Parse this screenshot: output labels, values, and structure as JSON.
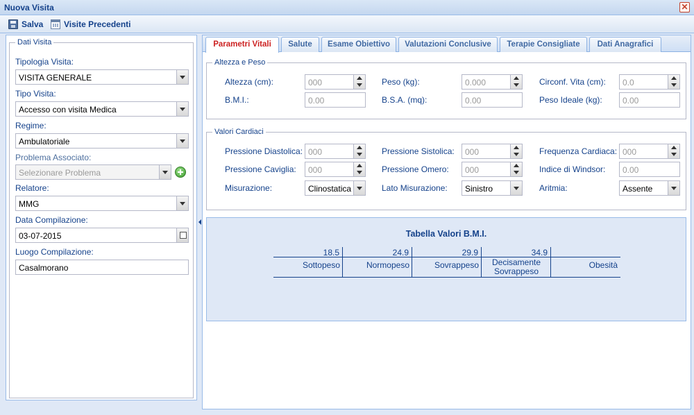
{
  "window": {
    "title": "Nuova Visita",
    "close_glyph": "✕"
  },
  "toolbar": {
    "save_label": "Salva",
    "previous_label": "Visite Precedenti"
  },
  "left": {
    "legend": "Dati Visita",
    "tipologia_label": "Tipologia Visita:",
    "tipologia_value": "VISITA GENERALE",
    "tipo_label": "Tipo Visita:",
    "tipo_value": "Accesso con visita Medica",
    "regime_label": "Regime:",
    "regime_value": "Ambulatoriale",
    "problema_label": "Problema Associato:",
    "problema_placeholder": "Selezionare Problema",
    "relatore_label": "Relatore:",
    "relatore_value": "MMG",
    "data_label": "Data Compilazione:",
    "data_value": "03-07-2015",
    "luogo_label": "Luogo Compilazione:",
    "luogo_value": "Casalmorano"
  },
  "tabs": [
    {
      "label": "Parametri Vitali"
    },
    {
      "label": "Salute"
    },
    {
      "label": "Esame Obiettivo"
    },
    {
      "label": "Valutazioni Conclusive"
    },
    {
      "label": "Terapie Consigliate"
    },
    {
      "label": "Dati Anagrafici"
    }
  ],
  "altezza_peso": {
    "legend": "Altezza e Peso",
    "altezza_label": "Altezza (cm):",
    "altezza_ph": "000",
    "peso_label": "Peso (kg):",
    "peso_ph": "0.000",
    "circonf_label": "Circonf. Vita (cm):",
    "circonf_ph": "0.0",
    "bmi_label": "B.M.I.:",
    "bmi_ph": "0.00",
    "bsa_label": "B.S.A. (mq):",
    "bsa_ph": "0.00",
    "peso_ideale_label": "Peso Ideale (kg):",
    "peso_ideale_ph": "0.00"
  },
  "cardiaci": {
    "legend": "Valori Cardiaci",
    "diastolica_label": "Pressione Diastolica:",
    "diastolica_ph": "000",
    "sistolica_label": "Pressione Sistolica:",
    "sistolica_ph": "000",
    "frequenza_label": "Frequenza Cardiaca:",
    "frequenza_ph": "000",
    "caviglia_label": "Pressione Caviglia:",
    "caviglia_ph": "000",
    "omero_label": "Pressione Omero:",
    "omero_ph": "000",
    "windsor_label": "Indice di Windsor:",
    "windsor_ph": "0.00",
    "misurazione_label": "Misurazione:",
    "misurazione_value": "Clinostatica",
    "lato_label": "Lato Misurazione:",
    "lato_value": "Sinistro",
    "aritmia_label": "Aritmia:",
    "aritmia_value": "Assente"
  },
  "bmi_table": {
    "title": "Tabella Valori B.M.I.",
    "thresholds": [
      "18.5",
      "24.9",
      "29.9",
      "34.9",
      ""
    ],
    "categories": [
      "Sottopeso",
      "Normopeso",
      "Sovrappeso",
      "Decisamente Sovrappeso",
      "Obesità"
    ]
  }
}
